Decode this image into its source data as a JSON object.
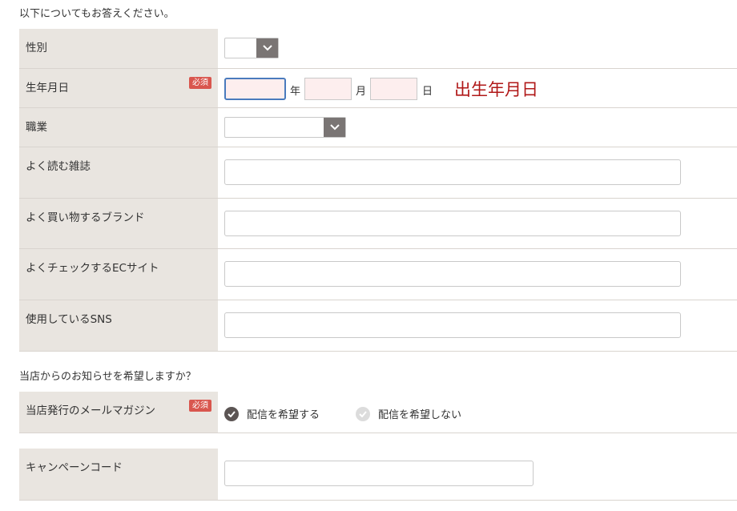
{
  "intro_text": "以下についてもお答えください。",
  "notify_text": "当店からのお知らせを希望しますか？",
  "required_badge": "必須",
  "fields": {
    "gender": "性別",
    "birthdate": "生年月日",
    "occupation": "職業",
    "magazines": "よく読む雑誌",
    "brands": "よく買い物するブランド",
    "ec_sites": "よくチェックするECサイト",
    "sns": "使用しているSNS",
    "mail_magazine": "当店発行のメールマガジン",
    "campaign_code": "キャンペーンコード"
  },
  "birthdate": {
    "year_unit": "年",
    "month_unit": "月",
    "day_unit": "日",
    "annotation": "出生年月日"
  },
  "mail_magazine_options": {
    "subscribe": "配信を希望する",
    "unsubscribe": "配信を希望しない",
    "selected": "subscribe"
  },
  "colors": {
    "label_bg": "#e9e5e0",
    "required_badge": "#d9564e",
    "annotation": "#b01818",
    "date_input_bg": "#fdeeee",
    "focus_border": "#4a7bbd"
  }
}
